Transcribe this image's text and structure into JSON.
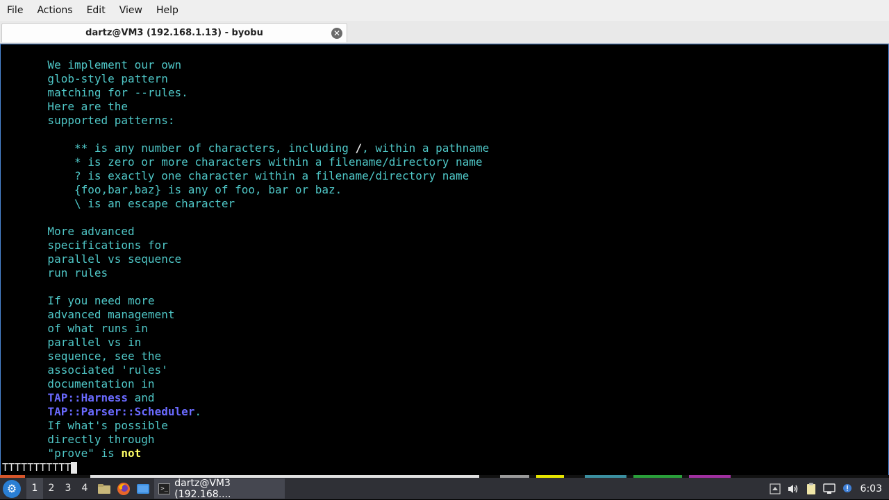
{
  "menubar": {
    "items": [
      "File",
      "Actions",
      "Edit",
      "View",
      "Help"
    ]
  },
  "tab": {
    "title": "dartz@VM3 (192.168.1.13) - byobu"
  },
  "terminal": {
    "lines": [
      [
        {
          "t": "       We implement our own"
        }
      ],
      [
        {
          "t": "       glob-style pattern"
        }
      ],
      [
        {
          "t": "       matching for --rules."
        }
      ],
      [
        {
          "t": "       Here are the"
        }
      ],
      [
        {
          "t": "       supported patterns:"
        }
      ],
      [
        {
          "t": ""
        }
      ],
      [
        {
          "t": "           ** is any number of characters, including "
        },
        {
          "t": "/",
          "s": "white"
        },
        {
          "t": ", within a pathname"
        }
      ],
      [
        {
          "t": "           * is zero or more characters within a filename/directory name"
        }
      ],
      [
        {
          "t": "           ? is exactly one character within a filename/directory name"
        }
      ],
      [
        {
          "t": "           {foo,bar,baz} is any of foo, bar or baz."
        }
      ],
      [
        {
          "t": "           \\ is an escape character"
        }
      ],
      [
        {
          "t": ""
        }
      ],
      [
        {
          "t": "       More advanced"
        }
      ],
      [
        {
          "t": "       specifications for"
        }
      ],
      [
        {
          "t": "       parallel vs sequence"
        }
      ],
      [
        {
          "t": "       run rules"
        }
      ],
      [
        {
          "t": ""
        }
      ],
      [
        {
          "t": "       If you need more"
        }
      ],
      [
        {
          "t": "       advanced management"
        }
      ],
      [
        {
          "t": "       of what runs in"
        }
      ],
      [
        {
          "t": "       parallel vs in"
        }
      ],
      [
        {
          "t": "       sequence, see the"
        }
      ],
      [
        {
          "t": "       associated 'rules'"
        }
      ],
      [
        {
          "t": "       documentation in"
        }
      ],
      [
        {
          "t": "       "
        },
        {
          "t": "TAP::Harness",
          "s": "blue"
        },
        {
          "t": " and"
        }
      ],
      [
        {
          "t": "       "
        },
        {
          "t": "TAP::Parser::Scheduler",
          "s": "blue"
        },
        {
          "t": "."
        }
      ],
      [
        {
          "t": "       If what's possible"
        }
      ],
      [
        {
          "t": "       directly through"
        }
      ],
      [
        {
          "t": "       \"prove\" is "
        },
        {
          "t": "not",
          "s": "yellow"
        }
      ]
    ],
    "prompt": "TTTTTTTTTTT",
    "colors": {
      "text": "#4fc7c7",
      "white": "#e8e8e8",
      "blue": "#6a6aff",
      "yellow": "#ffff66",
      "border": "#4c88d6"
    }
  },
  "status_colors": [
    "#d8562b",
    "#e0e0e0",
    "#9a9a9a",
    "#e6e600",
    "#3b8fa0",
    "#2a9f3a",
    "#a030a0"
  ],
  "taskbar": {
    "start_icon": "start-menu-icon",
    "workspaces": [
      "1",
      "2",
      "3",
      "4"
    ],
    "active_workspace": "1",
    "quicklaunch_icons": [
      "file-manager-icon",
      "firefox-icon",
      "desktop-icon"
    ],
    "task_label": "dartz@VM3 (192.168....",
    "task_icon": "terminal-icon",
    "tray_icons": [
      "up-arrow-icon",
      "volume-icon",
      "clipboard-icon",
      "network-icon",
      "notification-icon"
    ],
    "clock": "6:03"
  }
}
